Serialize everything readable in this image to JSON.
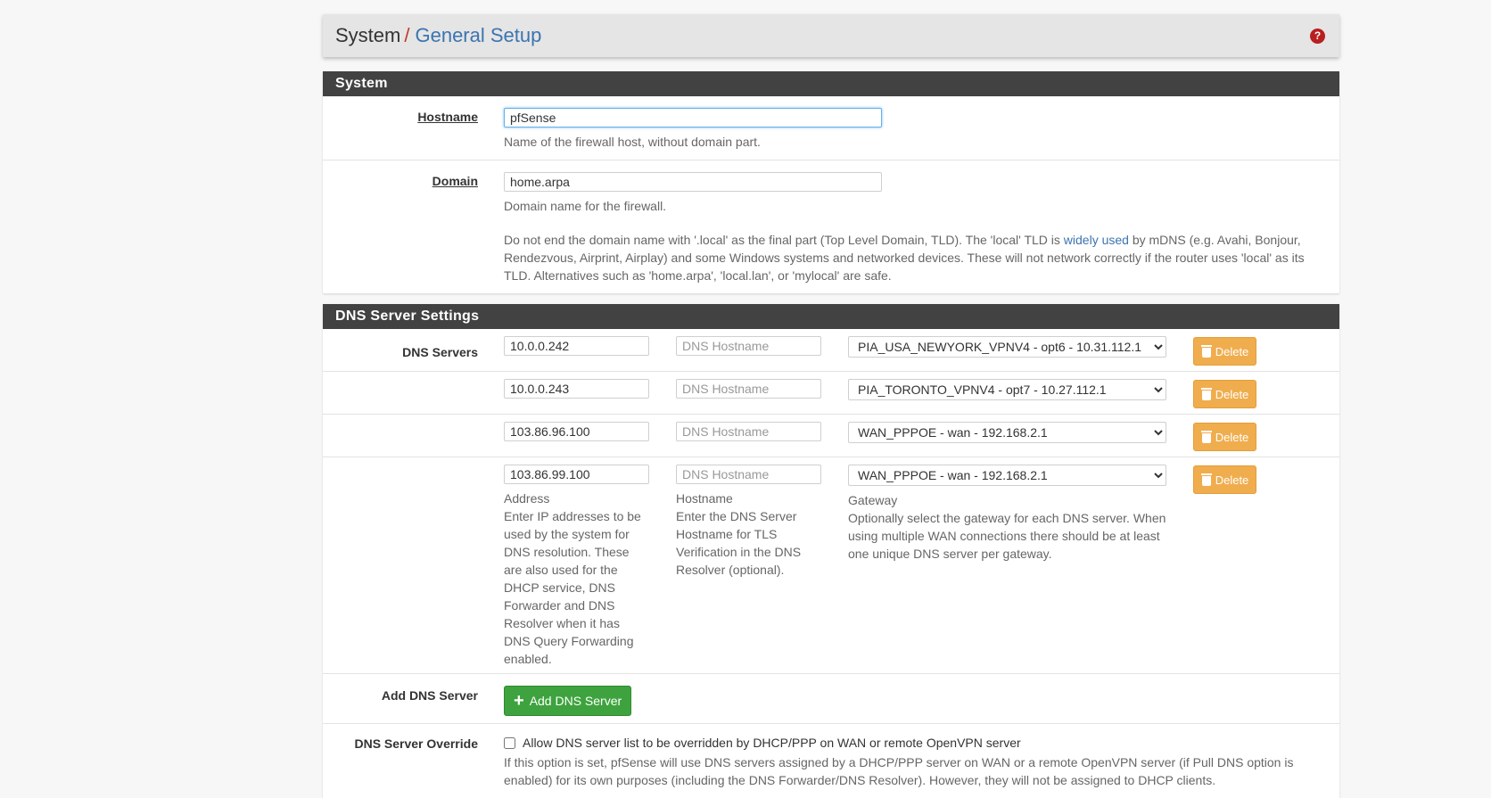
{
  "breadcrumb": {
    "root": "System",
    "separator": "/",
    "page": "General Setup",
    "help_icon": "?"
  },
  "system_section": {
    "title": "System",
    "hostname": {
      "label": "Hostname",
      "value": "pfSense",
      "help": "Name of the firewall host, without domain part."
    },
    "domain": {
      "label": "Domain",
      "value": "home.arpa",
      "help": "Domain name for the firewall.",
      "note_before_link": "Do not end the domain name with '.local' as the final part (Top Level Domain, TLD). The 'local' TLD is ",
      "note_link": "widely used",
      "note_after_link": " by mDNS (e.g. Avahi, Bonjour, Rendezvous, Airprint, Airplay) and some Windows systems and networked devices. These will not network correctly if the router uses 'local' as its TLD. Alternatives such as 'home.arpa', 'local.lan', or 'mylocal' are safe."
    }
  },
  "dns_section": {
    "title": "DNS Server Settings",
    "servers_label": "DNS Servers",
    "hostname_placeholder": "DNS Hostname",
    "delete_label": "Delete",
    "servers": [
      {
        "address": "10.0.0.242",
        "hostname": "",
        "gateway": "PIA_USA_NEWYORK_VPNV4 - opt6 - 10.31.112.1"
      },
      {
        "address": "10.0.0.243",
        "hostname": "",
        "gateway": "PIA_TORONTO_VPNV4 - opt7 - 10.27.112.1"
      },
      {
        "address": "103.86.96.100",
        "hostname": "",
        "gateway": "WAN_PPPOE - wan - 192.168.2.1"
      },
      {
        "address": "103.86.99.100",
        "hostname": "",
        "gateway": "WAN_PPPOE - wan - 192.168.2.1"
      }
    ],
    "address_help_title": "Address",
    "address_help": "Enter IP addresses to be used by the system for DNS resolution. These are also used for the DHCP service, DNS Forwarder and DNS Resolver when it has DNS Query Forwarding enabled.",
    "hostname_help_title": "Hostname",
    "hostname_help": "Enter the DNS Server Hostname for TLS Verification in the DNS Resolver (optional).",
    "gateway_help_title": "Gateway",
    "gateway_help": "Optionally select the gateway for each DNS server. When using multiple WAN connections there should be at least one unique DNS server per gateway.",
    "add_label": "Add DNS Server",
    "add_button": "Add DNS Server",
    "override_label": "DNS Server Override",
    "override_checkbox": "Allow DNS server list to be overridden by DHCP/PPP on WAN or remote OpenVPN server",
    "override_checked": false,
    "override_help": "If this option is set, pfSense will use DNS servers assigned by a DHCP/PPP server on WAN or a remote OpenVPN server (if Pull DNS option is enabled) for its own purposes (including the DNS Forwarder/DNS Resolver). However, they will not be assigned to DHCP clients."
  }
}
